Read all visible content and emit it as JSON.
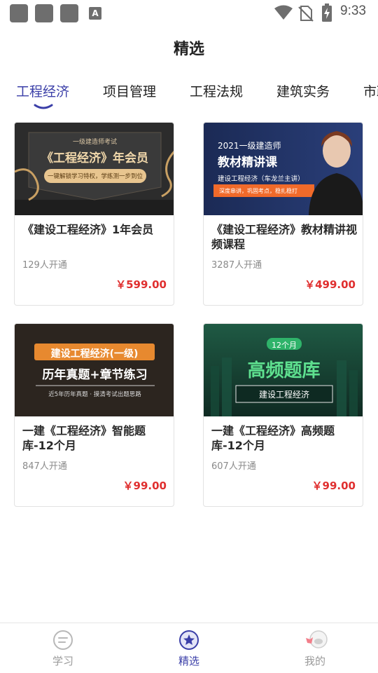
{
  "status_bar": {
    "time": "9:33",
    "icons": [
      "notification-square-icon",
      "notification-square-icon",
      "notification-square-icon",
      "font-a-icon",
      "wifi-icon",
      "no-sim-icon",
      "battery-charging-icon"
    ],
    "a_glyph": "A"
  },
  "page": {
    "title": "精选"
  },
  "tabs": [
    {
      "label": "工程经济",
      "active": true
    },
    {
      "label": "项目管理"
    },
    {
      "label": "工程法规"
    },
    {
      "label": "建筑实务"
    },
    {
      "label": "市政"
    }
  ],
  "courses": [
    {
      "title": "《建设工程经济》1年会员",
      "subscribers": "129人开通",
      "price": "￥599.00",
      "banner": {
        "top_line": "一级建造师考试",
        "headline": "《工程经济》年会员",
        "tagline": "一键解锁学习特权，学练测一步到位"
      }
    },
    {
      "title": "《建设工程经济》教材精讲视频课程",
      "subscribers": "3287人开通",
      "price": "￥499.00",
      "banner": {
        "line1": "2021一级建造师",
        "line2": "教材精讲课",
        "line3": "建设工程经济（车龙兰主讲）",
        "line4": "深度串讲，巩固考点，稳扎稳打"
      }
    },
    {
      "title": "一建《工程经济》智能题库-12个月",
      "subscribers": "847人开通",
      "price": "￥99.00",
      "banner": {
        "label": "建设工程经济(一级)",
        "headline": "历年真题+章节练习",
        "tagline": "近5年历年真题 · 摸清考试出题思路"
      }
    },
    {
      "title": "一建《工程经济》高频题库-12个月",
      "subscribers": "607人开通",
      "price": "￥99.00",
      "banner": {
        "badge": "12个月",
        "headline": "高频题库",
        "label": "建设工程经济"
      }
    }
  ],
  "bottom_nav": [
    {
      "label": "学习",
      "icon": "study-icon"
    },
    {
      "label": "精选",
      "icon": "featured-star-icon",
      "active": true
    },
    {
      "label": "我的",
      "icon": "profile-icon"
    }
  ],
  "colors": {
    "accent": "#3b3fa8",
    "price": "#e02f2f",
    "gold": "#e8a860"
  }
}
